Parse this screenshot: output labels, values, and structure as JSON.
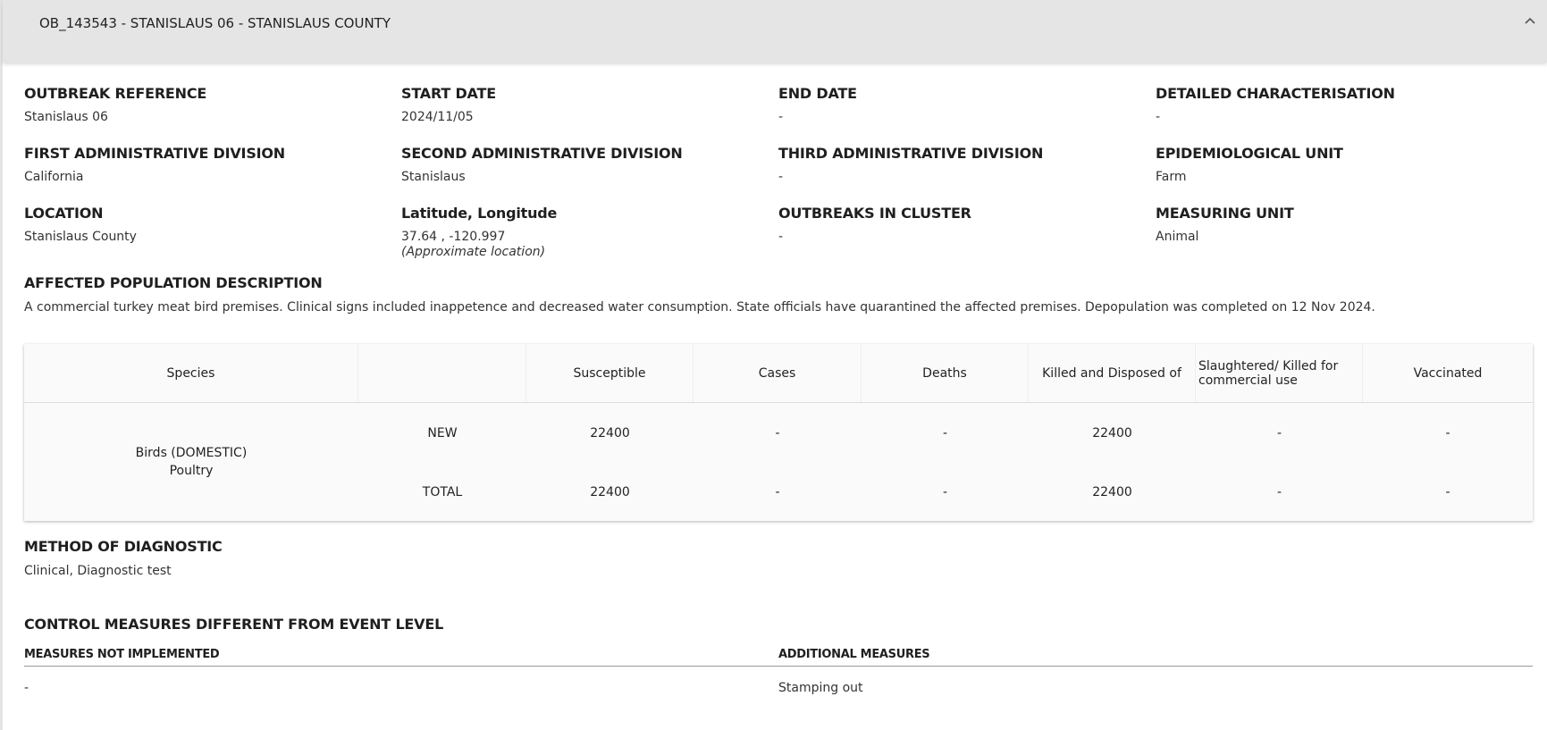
{
  "header": {
    "title": "OB_143543 - STANISLAUS 06 - STANISLAUS COUNTY"
  },
  "fields": {
    "outbreak_reference": {
      "label": "OUTBREAK REFERENCE",
      "value": "Stanislaus 06"
    },
    "start_date": {
      "label": "START DATE",
      "value": "2024/11/05"
    },
    "end_date": {
      "label": "END DATE",
      "value": "-"
    },
    "detailed_characterisation": {
      "label": "DETAILED CHARACTERISATION",
      "value": "-"
    },
    "first_admin": {
      "label": "FIRST ADMINISTRATIVE DIVISION",
      "value": "California"
    },
    "second_admin": {
      "label": "SECOND ADMINISTRATIVE DIVISION",
      "value": "Stanislaus"
    },
    "third_admin": {
      "label": "THIRD ADMINISTRATIVE DIVISION",
      "value": "-"
    },
    "epi_unit": {
      "label": "EPIDEMIOLOGICAL UNIT",
      "value": "Farm"
    },
    "location": {
      "label": "LOCATION",
      "value": "Stanislaus County"
    },
    "lat_long": {
      "label": "Latitude, Longitude",
      "value": "37.64 , -120.997",
      "note": "(Approximate location)"
    },
    "outbreaks_in_cluster": {
      "label": "OUTBREAKS IN CLUSTER",
      "value": "-"
    },
    "measuring_unit": {
      "label": "MEASURING UNIT",
      "value": "Animal"
    }
  },
  "affected_population": {
    "label": "AFFECTED POPULATION DESCRIPTION",
    "text": "A commercial turkey meat bird premises. Clinical signs included inappetence and decreased water consumption. State officials have quarantined the affected premises. Depopulation was completed on 12 Nov 2024."
  },
  "table": {
    "headers": [
      "Species",
      "Susceptible",
      "Cases",
      "Deaths",
      "Killed and Disposed of",
      "Slaughtered/ Killed for commercial use",
      "Vaccinated"
    ],
    "species_line1": "Birds (DOMESTIC)",
    "species_line2": "Poultry",
    "rows": [
      {
        "type": "NEW",
        "values": [
          "22400",
          "-",
          "-",
          "22400",
          "-",
          "-"
        ]
      },
      {
        "type": "TOTAL",
        "values": [
          "22400",
          "-",
          "-",
          "22400",
          "-",
          "-"
        ]
      }
    ]
  },
  "diagnostic": {
    "label": "METHOD OF DIAGNOSTIC",
    "value": "Clinical, Diagnostic test"
  },
  "control_measures": {
    "label": "CONTROL MEASURES DIFFERENT FROM EVENT LEVEL",
    "not_implemented_label": "MEASURES NOT IMPLEMENTED",
    "not_implemented_value": "-",
    "additional_label": "ADDITIONAL MEASURES",
    "additional_value": "Stamping out"
  }
}
